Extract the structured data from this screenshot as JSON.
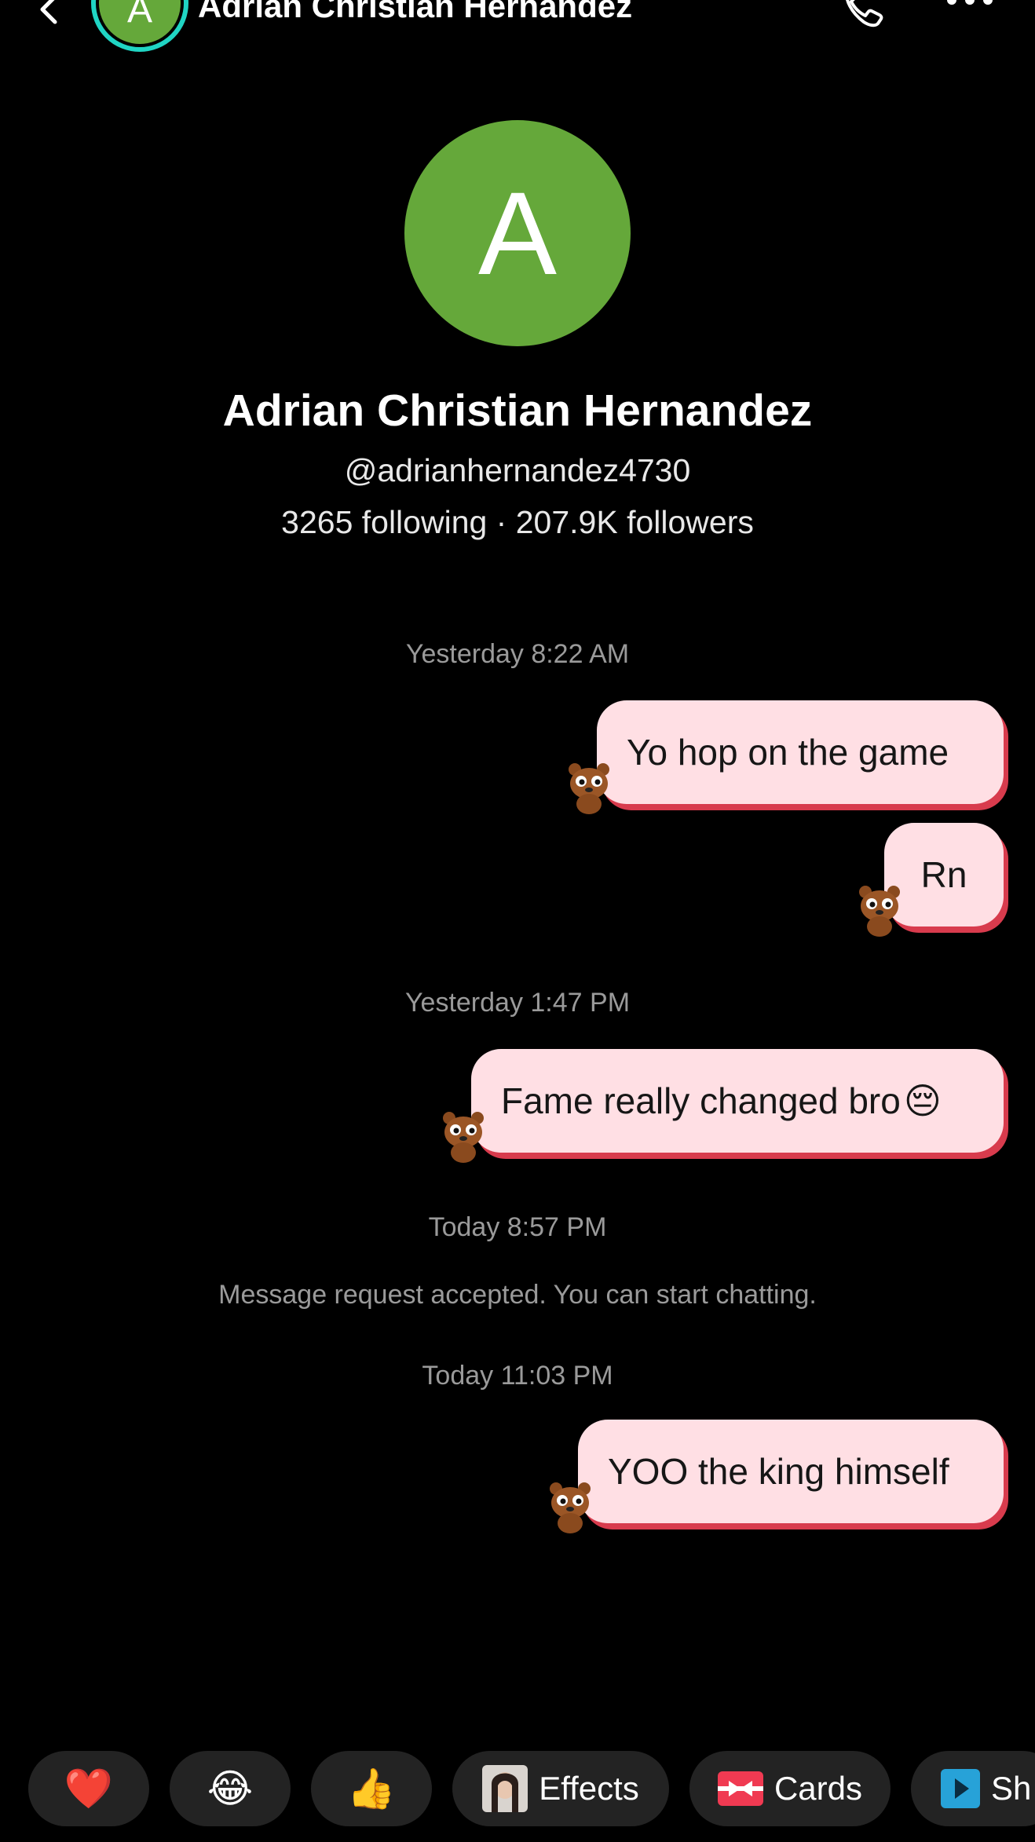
{
  "header": {
    "avatar_letter": "A",
    "name": "Adrian Christian Hernandez",
    "icons": {
      "back": "chevron-left-icon",
      "call": "phone-icon",
      "more": "more-horizontal-icon"
    }
  },
  "profile": {
    "avatar_letter": "A",
    "avatar_color": "#65a83a",
    "name": "Adrian Christian Hernandez",
    "handle": "@adrianhernandez4730",
    "stats": "3265 following · 207.9K followers"
  },
  "messages": {
    "ts1": "Yesterday 8:22 AM",
    "m1": "Yo hop on the game",
    "m2": "Rn",
    "ts2": "Yesterday 1:47 PM",
    "m3": "Fame really changed bro",
    "m3_emoji": "😔",
    "ts3": "Today 8:57 PM",
    "system": "Message request accepted. You can start chatting.",
    "ts4": "Today 11:03 PM",
    "m4": "YOO the king himself"
  },
  "quick_actions": {
    "heart": "❤️",
    "laugh": "😂",
    "thumbs": "👍",
    "effects_label": "Effects",
    "cards_label": "Cards",
    "share_label": "Sh"
  },
  "colors": {
    "bubble": "#ffdfe4",
    "bubble_shadow": "#d83b4d",
    "ring": "#20d5c4",
    "background": "#000000"
  }
}
